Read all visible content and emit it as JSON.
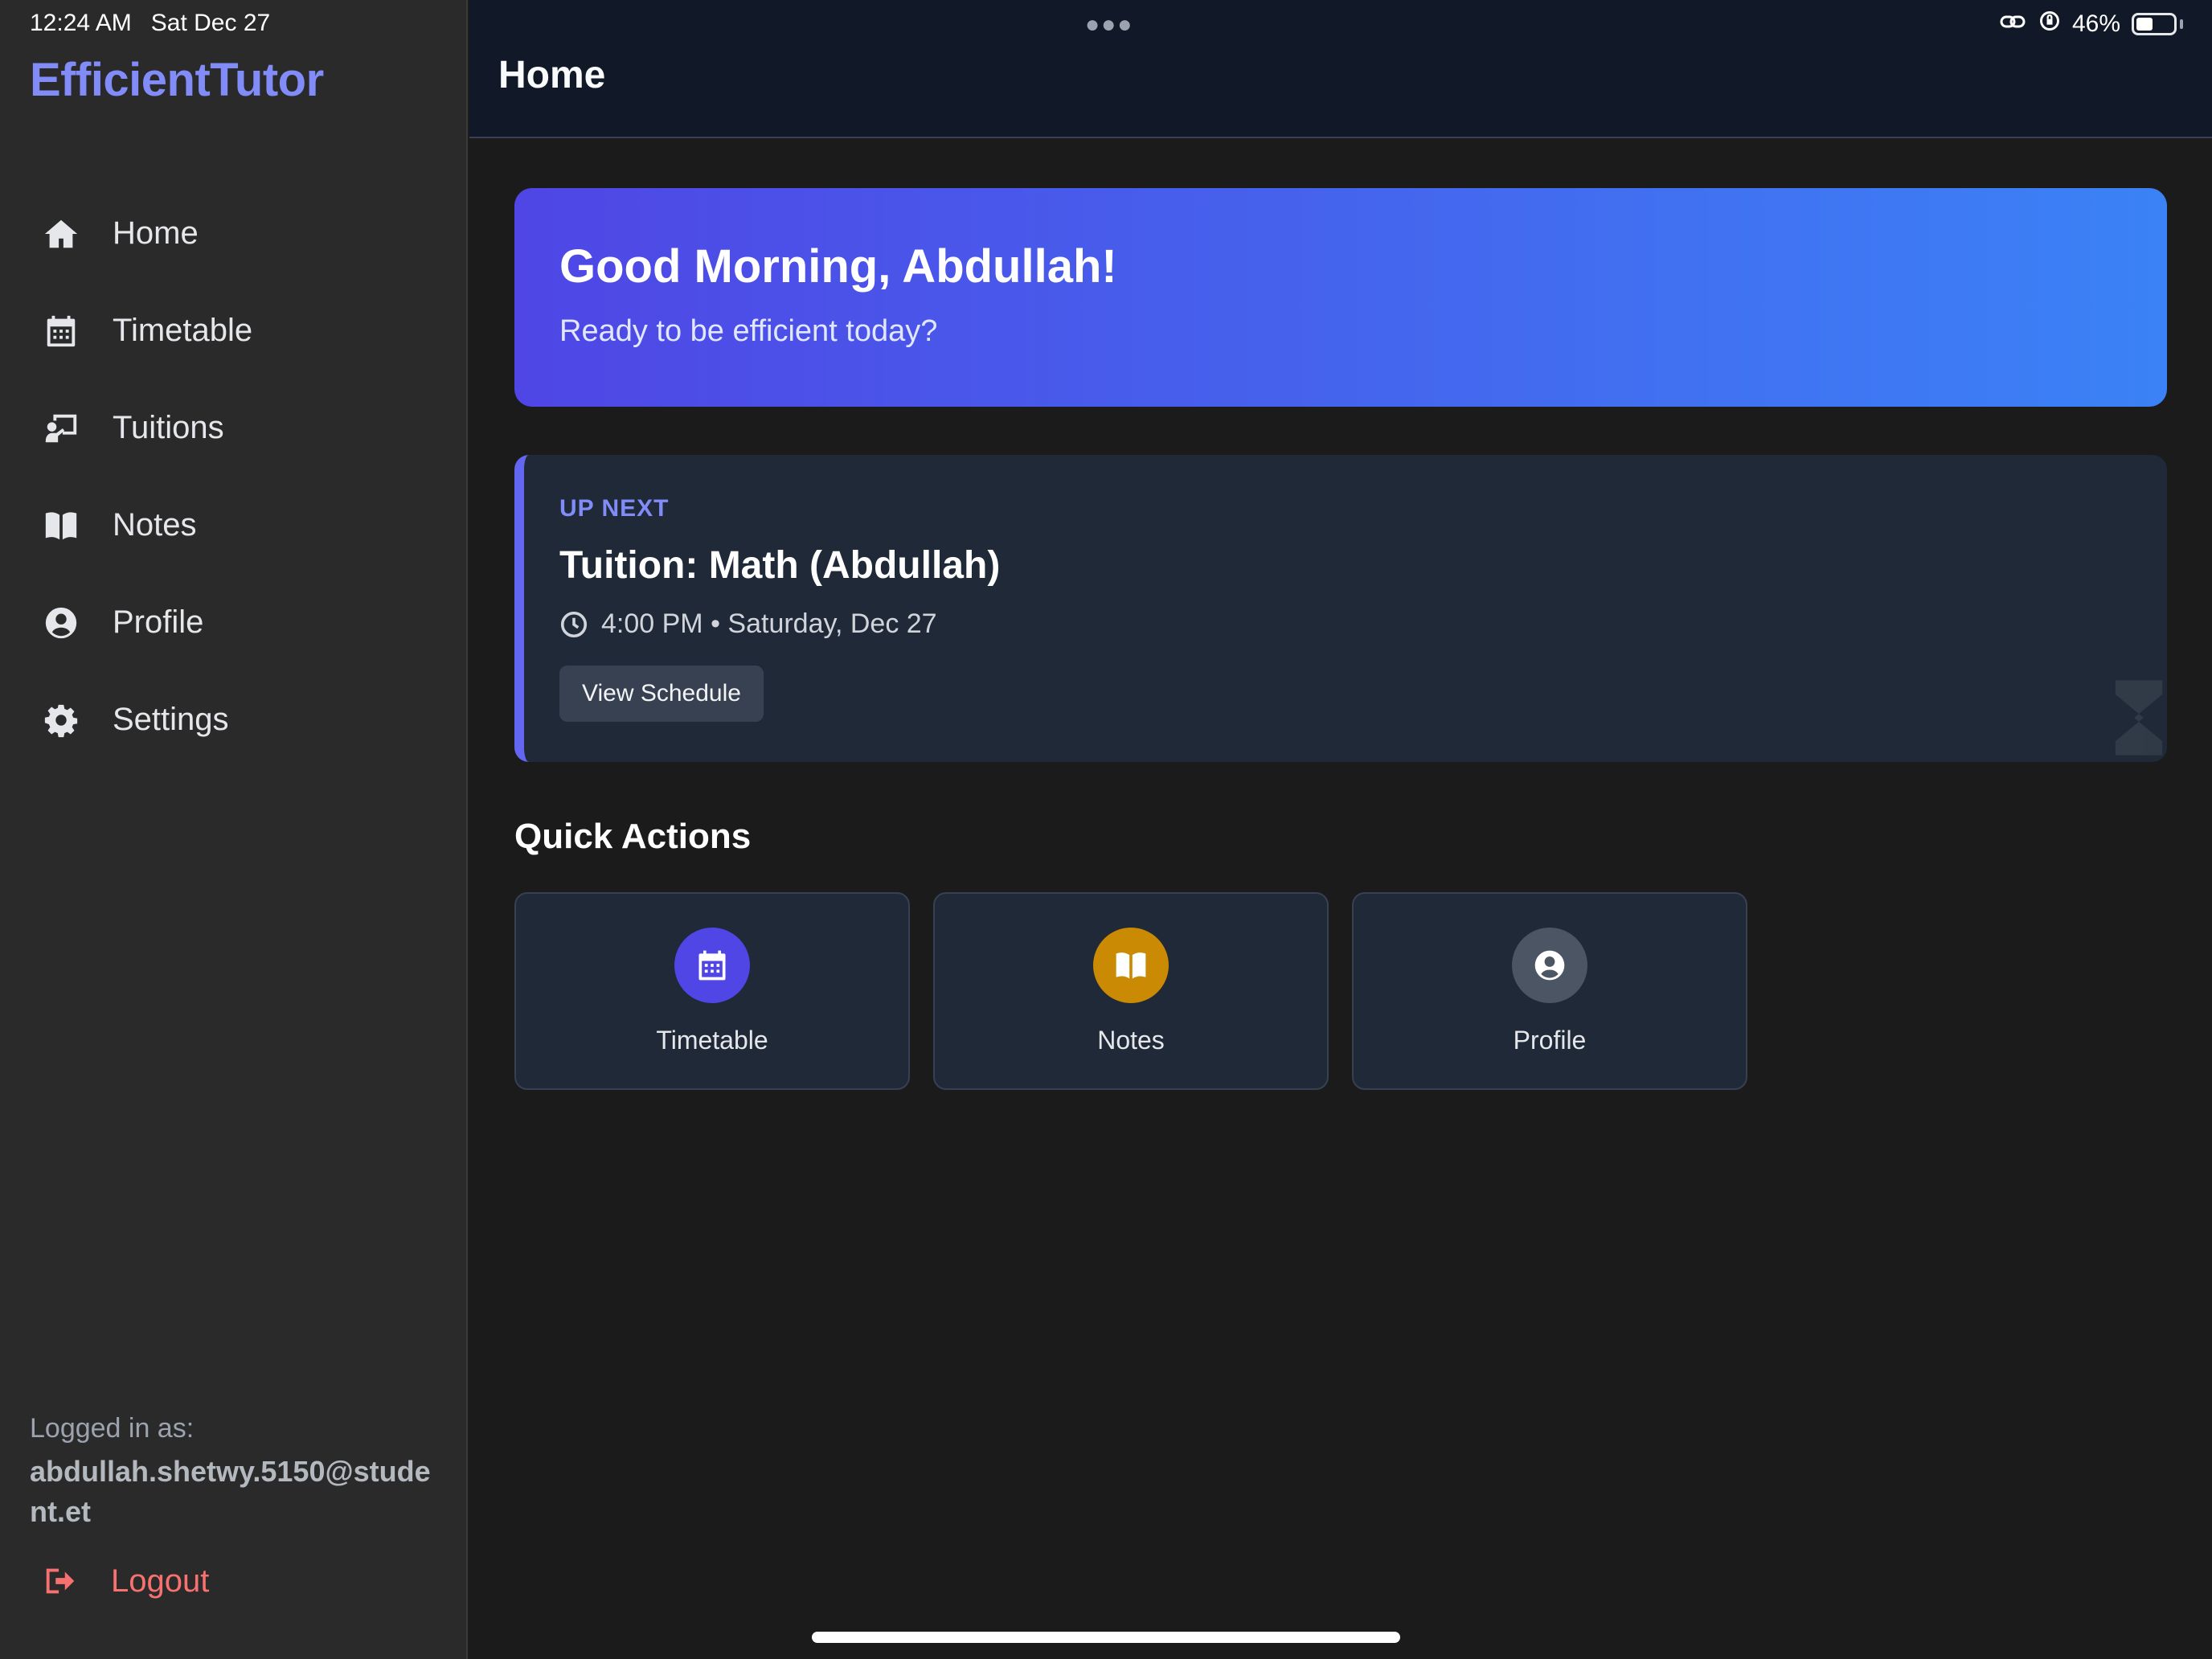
{
  "status_bar": {
    "time": "12:24 AM",
    "date": "Sat Dec 27",
    "battery": "46%",
    "battery_level": 0.46
  },
  "app": {
    "name": "EfficientTutor"
  },
  "sidebar": {
    "items": [
      {
        "label": "Home",
        "icon": "home-icon"
      },
      {
        "label": "Timetable",
        "icon": "calendar-icon"
      },
      {
        "label": "Tuitions",
        "icon": "teacher-board-icon"
      },
      {
        "label": "Notes",
        "icon": "book-icon"
      },
      {
        "label": "Profile",
        "icon": "user-circle-icon"
      },
      {
        "label": "Settings",
        "icon": "gear-icon"
      }
    ],
    "logged_in_label": "Logged in as:",
    "logged_in_email": "abdullah.shetwy.5150@student.et",
    "logout_label": "Logout"
  },
  "header": {
    "title": "Home"
  },
  "greeting": {
    "title": "Good Morning, Abdullah!",
    "subtitle": "Ready to be efficient today?"
  },
  "up_next": {
    "label": "UP NEXT",
    "title": "Tuition: Math (Abdullah)",
    "time": "4:00 PM • Saturday, Dec 27",
    "button": "View Schedule"
  },
  "quick_actions": {
    "title": "Quick Actions",
    "items": [
      {
        "label": "Timetable",
        "icon": "calendar-icon",
        "color": "#4f46e5"
      },
      {
        "label": "Notes",
        "icon": "book-icon",
        "color": "#ca8a04"
      },
      {
        "label": "Profile",
        "icon": "user-circle-icon",
        "color": "#4b5563"
      }
    ]
  },
  "colors": {
    "accent": "#818cf8",
    "logout": "#f87171",
    "gradient_start": "#4f46e5",
    "gradient_end": "#3b82f6"
  }
}
